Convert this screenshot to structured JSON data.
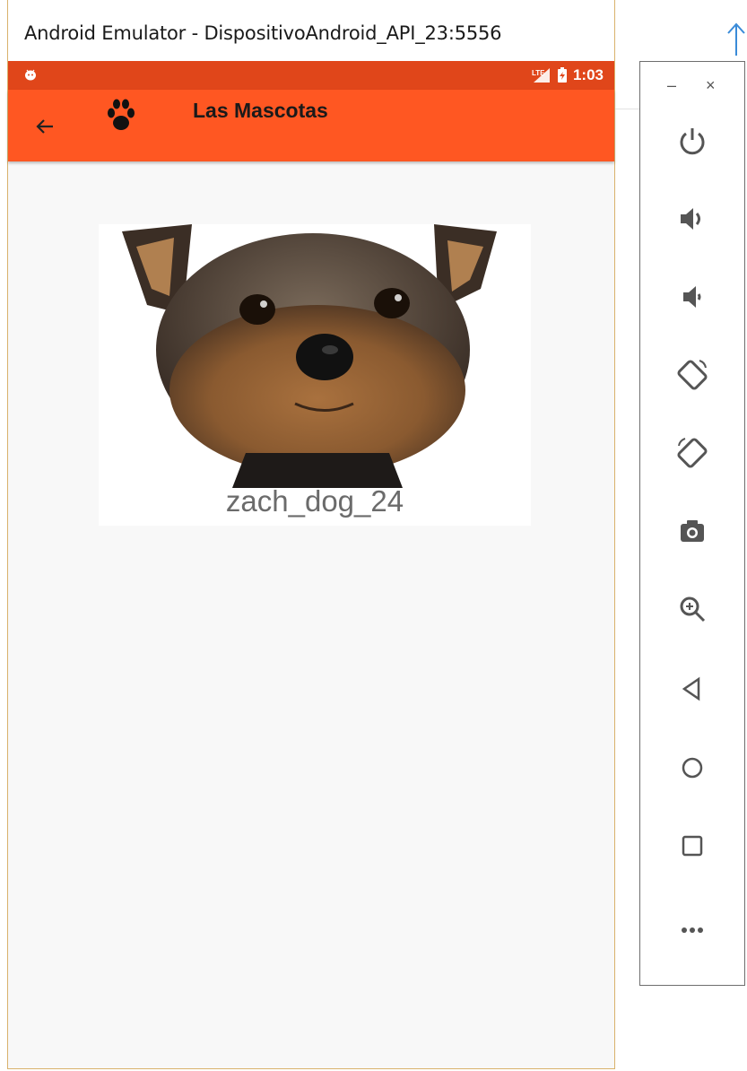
{
  "window": {
    "title": "Android Emulator - DispositivoAndroid_API_23:5556"
  },
  "status_bar": {
    "time": "1:03",
    "color": "#e0461a"
  },
  "toolbar": {
    "title": "Las Mascotas",
    "color": "#ff5722",
    "back_icon": "arrow-back-icon",
    "logo_icon": "paw-icon"
  },
  "pet": {
    "name": "zach_dog_24",
    "photo": "yorkshire-terrier-dog-photo"
  },
  "side_panel": {
    "minimize_label": "–",
    "close_label": "×",
    "buttons": [
      {
        "icon": "power-icon"
      },
      {
        "icon": "volume-up-icon"
      },
      {
        "icon": "volume-down-icon"
      },
      {
        "icon": "rotate-left-icon"
      },
      {
        "icon": "rotate-right-icon"
      },
      {
        "icon": "camera-icon"
      },
      {
        "icon": "zoom-icon"
      },
      {
        "icon": "back-triangle-icon"
      },
      {
        "icon": "home-circle-icon"
      },
      {
        "icon": "overview-square-icon"
      },
      {
        "icon": "more-icon"
      }
    ]
  }
}
